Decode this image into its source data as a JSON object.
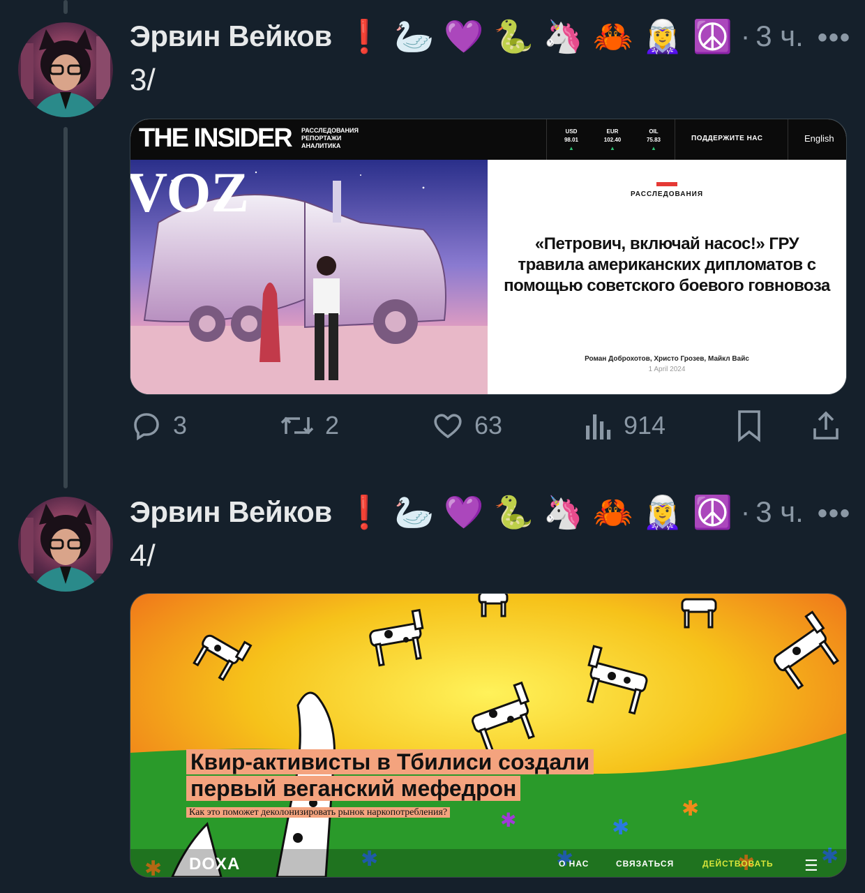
{
  "tweets": [
    {
      "author": "Эрвин Вейков",
      "emoji_badges": [
        "❗",
        "🦢",
        "💜",
        "🐍",
        "🦄",
        "🦀",
        "🧝‍♀️",
        "☮️"
      ],
      "time_separator": "·",
      "time": "3 ч.",
      "more": "•••",
      "text": "3/",
      "card": {
        "logo": "THE INSIDER",
        "tagline": [
          "РАССЛЕДОВАНИЯ",
          "РЕПОРТАЖИ",
          "АНАЛИТИКА"
        ],
        "rates": [
          {
            "label": "USD",
            "value": "98.01"
          },
          {
            "label": "EUR",
            "value": "102.40"
          },
          {
            "label": "OIL",
            "value": "75.83"
          }
        ],
        "support": "ПОДДЕРЖИТЕ НАС",
        "language": "English",
        "image_text": "VOZ",
        "category": "РАССЛЕДОВАНИЯ",
        "headline": "«Петрович, включай насос!» ГРУ травила американских дипломатов с помощью советского боевого говновоза",
        "authors": "Роман Доброхотов, Христо Грозев, Майкл Вайс",
        "date": "1 April 2024"
      },
      "actions": {
        "replies": "3",
        "retweets": "2",
        "likes": "63",
        "views": "914"
      }
    },
    {
      "author": "Эрвин Вейков",
      "emoji_badges": [
        "❗",
        "🦢",
        "💜",
        "🐍",
        "🦄",
        "🦀",
        "🧝‍♀️",
        "☮️"
      ],
      "time_separator": "·",
      "time": "3 ч.",
      "more": "•••",
      "text": "4/",
      "card": {
        "headline_line1": "Квир-активисты в Тбилиси создали",
        "headline_line2": "первый веганский мефедрон",
        "subtitle": "Как это поможет деколонизировать рынок наркопотребления?",
        "logo": "DOXA",
        "nav": [
          "О НАС",
          "СВЯЗАТЬСЯ",
          "ДЕЙСТВОВАТЬ"
        ],
        "menu": "☰"
      }
    }
  ],
  "colors": {
    "background": "#15202b",
    "text": "#e7e9ea",
    "muted": "#8b98a5",
    "thread_line": "#38444d",
    "doxa_accent": "#d8e63a"
  }
}
